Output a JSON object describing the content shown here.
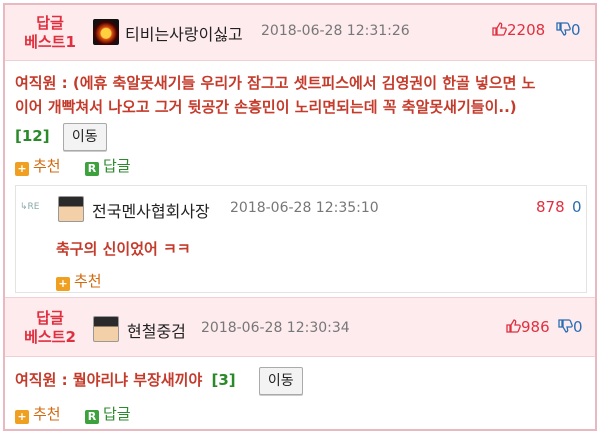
{
  "post1": {
    "badge_line1": "답글",
    "badge_line2": "베스트1",
    "nickname": "티비는사랑이싫고",
    "date": "2018-06-28 12:31:26",
    "likes": "2208",
    "dislikes": "0",
    "body_line1": "여직원 : (에휴 축알못새기들 우리가 잠그고 셋트피스에서 김영권이 한골 넣으면 노",
    "body_line2": "이어 개빡쳐서 나오고 그거 뒷공간 손흥민이 노리면되는데 꼭 축알못새기들이..)",
    "count": "[12]",
    "move_label": "이동",
    "recommend_label": "추천",
    "reply_label": "답글"
  },
  "reply": {
    "re_label": "RE",
    "nickname": "전국멘사협회사장",
    "date": "2018-06-28 12:35:10",
    "likes": "878",
    "dislikes": "0",
    "body": "축구의 신이었어 ㅋㅋ",
    "recommend_label": "추천"
  },
  "post2": {
    "badge_line1": "답글",
    "badge_line2": "베스트2",
    "nickname": "현철중검",
    "date": "2018-06-28 12:30:34",
    "likes": "986",
    "dislikes": "0",
    "body": "여직원 : 뭘야리냐 부장새끼야",
    "count": "[3]",
    "move_label": "이동",
    "recommend_label": "추천",
    "reply_label": "답글"
  },
  "colors": {
    "accent_red": "#e0303f",
    "header_pink": "#fdebee",
    "dislike_blue": "#2a6db3"
  }
}
